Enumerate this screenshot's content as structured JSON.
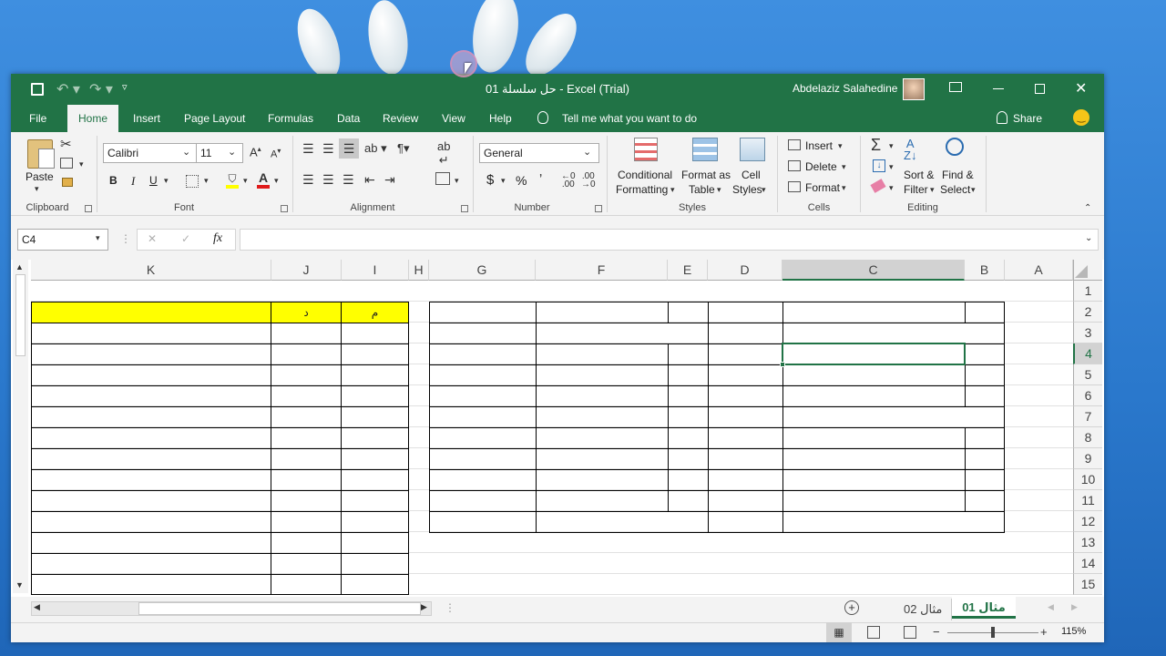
{
  "window": {
    "title": "حل سلسلة 01  -  Excel (Trial)",
    "user": "Abdelaziz Salahedine"
  },
  "tabs": [
    "File",
    "Home",
    "Insert",
    "Page Layout",
    "Formulas",
    "Data",
    "Review",
    "View",
    "Help"
  ],
  "tell_me": "Tell me what you want to do",
  "share": "Share",
  "ribbon": {
    "clipboard": {
      "label": "Clipboard",
      "paste": "Paste"
    },
    "font": {
      "label": "Font",
      "name": "Calibri",
      "size": "11",
      "bold": "B",
      "italic": "I",
      "underline": "U"
    },
    "alignment": {
      "label": "Alignment"
    },
    "number": {
      "label": "Number",
      "format": "General",
      "currency": "$",
      "percent": "%",
      "comma": "ʼ"
    },
    "styles": {
      "label": "Styles",
      "conditional": "Conditional",
      "conditional2": "Formatting",
      "format_table": "Format as",
      "format_table2": "Table",
      "cell_styles": "Cell",
      "cell_styles2": "Styles"
    },
    "cells": {
      "label": "Cells",
      "insert": "Insert",
      "delete": "Delete",
      "format": "Format"
    },
    "editing": {
      "label": "Editing",
      "sort": "Sort &",
      "sort2": "Filter",
      "find": "Find &",
      "find2": "Select"
    }
  },
  "formula_bar": {
    "name_box": "C4",
    "fx": "fx",
    "cancel": "✕",
    "enter": "✓",
    "value": ""
  },
  "columns": [
    "K",
    "J",
    "I",
    "H",
    "G",
    "F",
    "E",
    "D",
    "C",
    "B",
    "A"
  ],
  "rows": [
    "1",
    "2",
    "3",
    "4",
    "5",
    "6",
    "7",
    "8",
    "9",
    "10",
    "11",
    "12",
    "13",
    "14",
    "15"
  ],
  "cells": {
    "I2": "م",
    "J2": "د"
  },
  "sheets": [
    "مثال 02",
    "مثال 01"
  ],
  "active_sheet": "مثال 01",
  "zoom": "115%",
  "colors": {
    "excel_green": "#217346",
    "yellow_fill": "#ffff00",
    "selected_header": "#d2d2d2"
  }
}
